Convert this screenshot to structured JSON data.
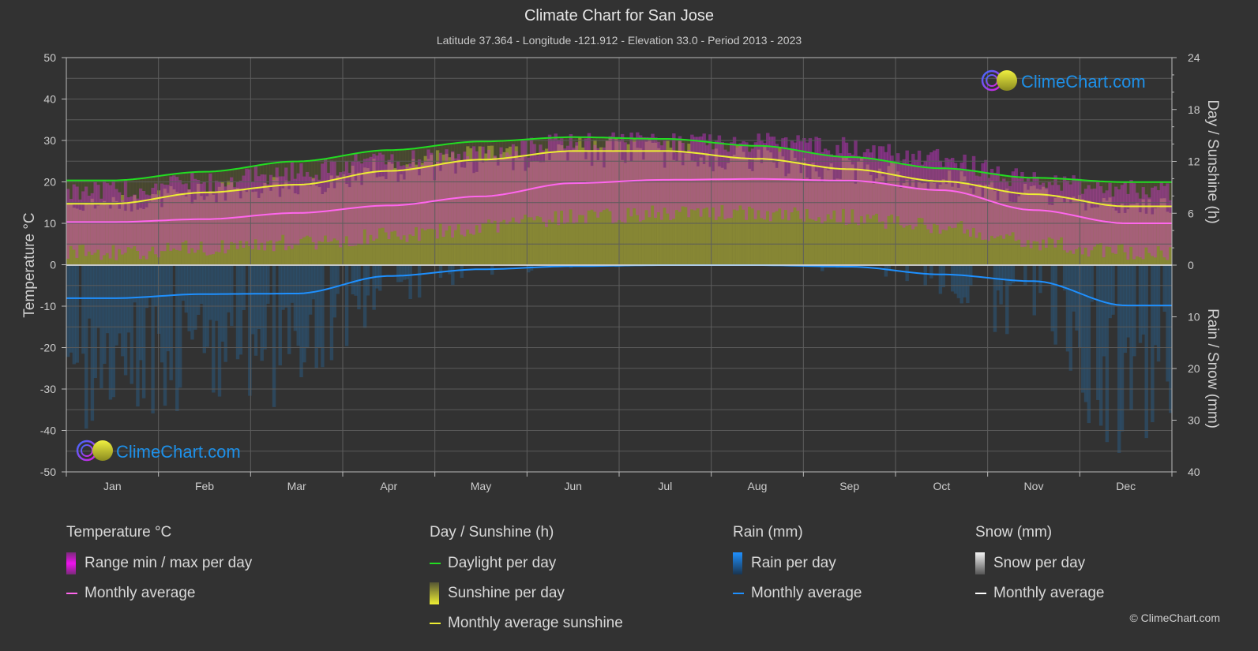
{
  "header": {
    "title": "Climate Chart for San Jose",
    "subtitle": "Latitude 37.364 - Longitude -121.912 - Elevation 33.0 - Period 2013 - 2023"
  },
  "logo_text": "ClimeChart.com",
  "copyright": "© ClimeChart.com",
  "legend": {
    "temperature": {
      "heading": "Temperature °C",
      "items": [
        "Range min / max per day",
        "Monthly average"
      ]
    },
    "sunshine": {
      "heading": "Day / Sunshine (h)",
      "items": [
        "Daylight per day",
        "Sunshine per day",
        "Monthly average sunshine"
      ]
    },
    "rain": {
      "heading": "Rain (mm)",
      "items": [
        "Rain per day",
        "Monthly average"
      ]
    },
    "snow": {
      "heading": "Snow (mm)",
      "items": [
        "Snow per day",
        "Monthly average"
      ]
    }
  },
  "colors": {
    "temp_avg": "#ff66ee",
    "daylight": "#22dd22",
    "sunshine_avg": "#eeee33",
    "rain_avg": "#1e90ff",
    "snow_avg": "#ffffff",
    "temp_range": "#cc33cc",
    "sunshine_fill": "#8a8a35",
    "rain_fill": "#2a5a80"
  },
  "chart_data": {
    "type": "line",
    "title": "Climate Chart for San Jose",
    "categories": [
      "Jan",
      "Feb",
      "Mar",
      "Apr",
      "May",
      "Jun",
      "Jul",
      "Aug",
      "Sep",
      "Oct",
      "Nov",
      "Dec"
    ],
    "axes": {
      "left": {
        "label": "Temperature °C",
        "range": [
          -50,
          50
        ],
        "ticks": [
          "50",
          "40",
          "30",
          "20",
          "10",
          "0",
          "-10",
          "-20",
          "-30",
          "-40",
          "-50"
        ]
      },
      "right_top": {
        "label": "Day / Sunshine (h)",
        "range": [
          0,
          24
        ],
        "ticks": [
          "24",
          "18",
          "12",
          "6",
          "0"
        ]
      },
      "right_bottom": {
        "label": "Rain / Snow (mm)",
        "range": [
          0,
          40
        ],
        "ticks": [
          "0",
          "10",
          "20",
          "30",
          "40"
        ]
      }
    },
    "grid": true,
    "series": [
      {
        "name": "Temperature monthly average (°C)",
        "axis": "left",
        "values": [
          10.3,
          11.0,
          12.5,
          14.3,
          16.5,
          19.7,
          20.5,
          20.7,
          20.3,
          18.0,
          13.2,
          10.0
        ]
      },
      {
        "name": "Daylight per day (h)",
        "axis": "right_top",
        "values": [
          9.8,
          10.8,
          12.0,
          13.3,
          14.3,
          14.8,
          14.6,
          13.8,
          12.5,
          11.2,
          10.1,
          9.6
        ]
      },
      {
        "name": "Monthly average sunshine (h)",
        "axis": "right_top",
        "values": [
          7.1,
          8.4,
          9.3,
          10.9,
          12.2,
          13.2,
          13.2,
          12.3,
          11.1,
          9.7,
          8.2,
          6.8
        ]
      },
      {
        "name": "Rain monthly average (mm)",
        "axis": "right_bottom",
        "values": [
          6.4,
          5.6,
          5.5,
          2.1,
          0.8,
          0.2,
          0.0,
          0.0,
          0.3,
          1.8,
          3.1,
          7.8
        ]
      },
      {
        "name": "Snow monthly average (mm)",
        "axis": "right_bottom",
        "values": [
          0,
          0,
          0,
          0,
          0,
          0,
          0,
          0,
          0,
          0,
          0,
          0
        ]
      }
    ],
    "ranges": {
      "temp_max_approx": [
        17.5,
        19.5,
        22,
        24.5,
        26.5,
        29,
        29,
        29,
        28,
        25,
        20,
        17.5
      ],
      "temp_min_approx": [
        3,
        4,
        5.5,
        7,
        9,
        11.5,
        12.5,
        12.5,
        11.5,
        9,
        5.5,
        3
      ]
    },
    "legend_position": "bottom"
  }
}
